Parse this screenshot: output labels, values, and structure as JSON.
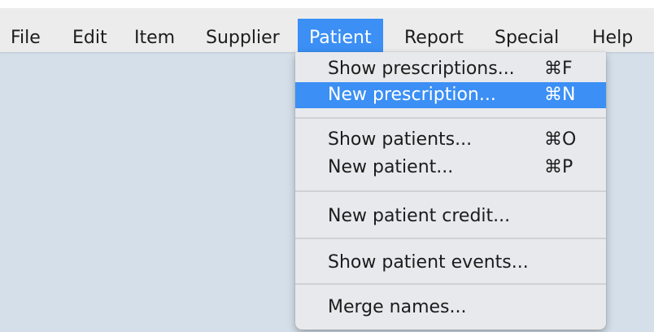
{
  "menubar": {
    "items": [
      {
        "label": "File"
      },
      {
        "label": "Edit"
      },
      {
        "label": "Item"
      },
      {
        "label": "Supplier"
      },
      {
        "label": "Patient",
        "active": true
      },
      {
        "label": "Report"
      },
      {
        "label": "Special"
      },
      {
        "label": "Help"
      }
    ]
  },
  "dropdown": {
    "parent": "Patient",
    "items": [
      {
        "label": "Show prescriptions...",
        "shortcut": "⌘F"
      },
      {
        "label": "New prescription...",
        "shortcut": "⌘N",
        "highlighted": true
      },
      {
        "label": "Show patients...",
        "shortcut": "⌘O"
      },
      {
        "label": "New patient...",
        "shortcut": "⌘P"
      },
      {
        "label": "New patient credit...",
        "shortcut": ""
      },
      {
        "label": "Show patient events...",
        "shortcut": ""
      },
      {
        "label": "Merge names...",
        "shortcut": ""
      }
    ]
  },
  "colors": {
    "highlight": "#3b8ff5",
    "menubar_background": "#ececec",
    "menu_background": "#e8e9ec",
    "desktop_background": "#d5dfe9"
  }
}
